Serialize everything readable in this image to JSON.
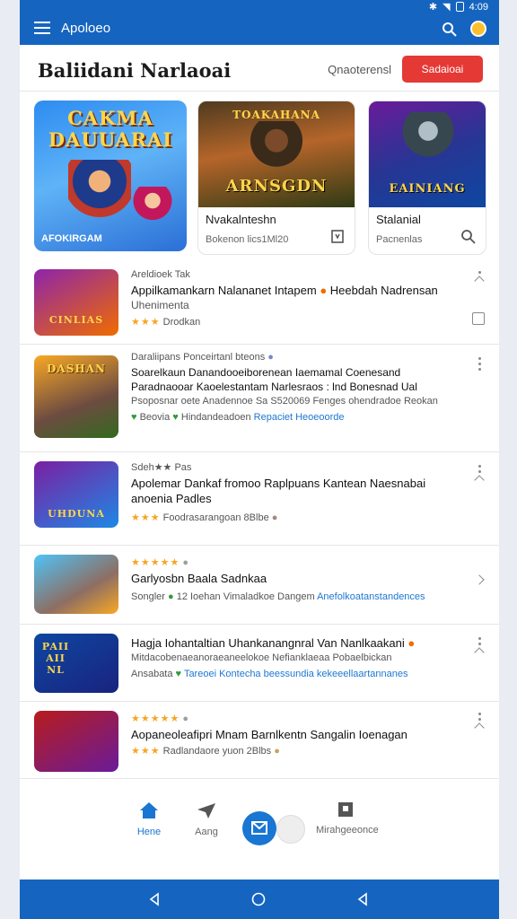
{
  "status_bar": {
    "time": "4:09"
  },
  "app_bar": {
    "title": "Apoloeo",
    "search_icon": "search-icon",
    "avatar_icon": "avatar-icon"
  },
  "header": {
    "title": "Baliidani Narlaoai",
    "link_label": "Qnaoterensl",
    "button_label": "Sadaioai"
  },
  "feature": {
    "big": {
      "art_text": "CAKMA DAUUARAI",
      "tag": "AFOKIRGAM"
    },
    "cards": [
      {
        "art_top": "TOAKAHANA",
        "art_text": "ARNSGDN",
        "title": "Nvakalnteshn",
        "subtitle": "Bokenon lics1Ml20",
        "icon": "bookmark-icon"
      },
      {
        "art_text": "EAINIANG",
        "title": "Stalanial",
        "subtitle": "Pacnenlas",
        "icon": "search-icon"
      }
    ]
  },
  "list": [
    {
      "meta": "Areldioek Tak",
      "title": "Appilkamankarn Nalananet Intapem",
      "title_tail": "Heebdah Nadrensan",
      "sub": "Uhenimenta",
      "footer_stars": "★★★",
      "footer_text": "Drodkan",
      "art_text": "CINLIAS",
      "side_icon": "edit-icon"
    },
    {
      "meta": "Daraliipans Ponceirtanl bteons",
      "title": "Soarelkaun Danandooeiborenean Iaemamal Coenesand Paradnaooar Kaoelestantam Narlesraos : lnd Bonesnad Ual",
      "sub": "Psoposnar oete Anadennoe Sa S520069 Fenges ohendradoe Reokan",
      "footer_a": "Beovia",
      "footer_b": "Hindandeadoen",
      "footer_link": "Repaciet Heoeoorde",
      "art_text": "DASHAN"
    },
    {
      "meta": "Sdeh★★ Pas",
      "title": "Apolemar Dankaf fromoo Raplpuans Kantean Naesnabai anoenia Padles",
      "footer_stars": "★★★",
      "footer_text": "Foodrasarangoan 8Blbe",
      "art_text": "UHDUNA"
    },
    {
      "meta_stars": "★★★★★",
      "title": "Garlyosbn Baala Sadnkaa",
      "sub_a": "Songler",
      "sub_b": "12  Ioehan Vimaladkoe Dangem",
      "sub_link": "Anefolkoatanstandences"
    },
    {
      "title": "Hagja Iohantaltian Uhankanangnral Van Nanlkaakani",
      "sub": "Mitdacobenaeanoraeaneelokoe Nefianklaeaa Pobaelbickan",
      "footer_a": "Ansabata",
      "footer_link": "Tareoei Kontecha beessundia kekeeellaartannanes",
      "art_text": "PAII AII NL"
    },
    {
      "meta_stars": "★★★★★",
      "title": "Aopaneoleafipri Mnam Barnlkentn Sangalin Ioenagan",
      "footer_stars": "★★★",
      "footer_text": "Radlandaore yuon 2Blbs"
    }
  ],
  "bottom_nav": {
    "home_label": "Hene",
    "send_label": "Aang",
    "manage_label": "Mirahgeeonce"
  },
  "colors": {
    "primary": "#1565c0",
    "accent": "#e53935",
    "star": "#f5a623"
  }
}
